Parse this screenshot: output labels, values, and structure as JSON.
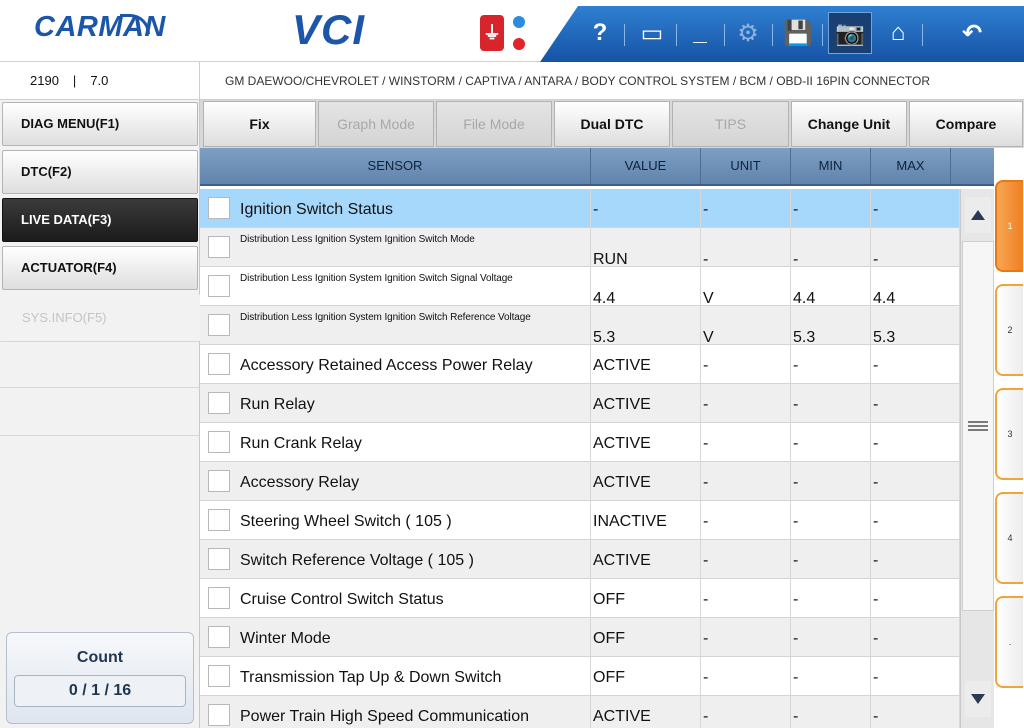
{
  "header": {
    "logo": "CARMAN",
    "product": "VCI",
    "usb_icon": "usb-icon",
    "toolbar": [
      {
        "name": "help-button",
        "label": "?",
        "icon": "question-icon",
        "state": "normal"
      },
      {
        "name": "window-button",
        "label": "▭",
        "icon": "window-icon",
        "state": "normal"
      },
      {
        "name": "minimize-button",
        "label": "_",
        "icon": "minimize-icon",
        "state": "normal"
      },
      {
        "name": "settings-button",
        "label": "⚙",
        "icon": "gear-icon",
        "state": "disabled"
      },
      {
        "name": "save-button",
        "label": "💾",
        "icon": "save-icon",
        "state": "normal"
      },
      {
        "name": "camera-button",
        "label": "📷",
        "icon": "camera-icon",
        "state": "active"
      },
      {
        "name": "home-button",
        "label": "⌂",
        "icon": "home-icon",
        "state": "normal"
      },
      {
        "name": "back-button",
        "label": "↶",
        "icon": "back-icon",
        "state": "normal"
      }
    ]
  },
  "info": {
    "code": "2190",
    "separator": "|",
    "version": "7.0",
    "path": "GM DAEWOO/CHEVROLET / WINSTORM / CAPTIVA / ANTARA / BODY CONTROL SYSTEM / BCM / OBD-II 16PIN CONNECTOR"
  },
  "menu": {
    "items": [
      {
        "label": "DIAG MENU(F1)",
        "state": "normal"
      },
      {
        "label": "DTC(F2)",
        "state": "normal"
      },
      {
        "label": "LIVE DATA(F3)",
        "state": "active"
      },
      {
        "label": "ACTUATOR(F4)",
        "state": "normal"
      },
      {
        "label": "SYS.INFO(F5)",
        "state": "disabled"
      }
    ],
    "count_title": "Count",
    "count_value": "0 / 1 / 16"
  },
  "functions": [
    {
      "label": "Fix",
      "enabled": true
    },
    {
      "label": "Graph Mode",
      "enabled": false
    },
    {
      "label": "File Mode",
      "enabled": false
    },
    {
      "label": "Dual DTC",
      "enabled": true
    },
    {
      "label": "TIPS",
      "enabled": false
    },
    {
      "label": "Change Unit",
      "enabled": true
    },
    {
      "label": "Compare",
      "enabled": true
    }
  ],
  "table": {
    "columns": [
      "SENSOR",
      "VALUE",
      "UNIT",
      "MIN",
      "MAX"
    ],
    "rows": [
      {
        "sensor": "Ignition Switch Status",
        "value": "-",
        "unit": "-",
        "min": "-",
        "max": "-",
        "small": false,
        "selected": true
      },
      {
        "sensor": "Distribution Less Ignition System Ignition Switch Mode",
        "value": "RUN",
        "unit": "-",
        "min": "-",
        "max": "-",
        "small": true,
        "selected": false
      },
      {
        "sensor": "Distribution Less Ignition System Ignition Switch Signal Voltage",
        "value": "4.4",
        "unit": "V",
        "min": "4.4",
        "max": "4.4",
        "small": true,
        "selected": false
      },
      {
        "sensor": "Distribution Less Ignition System Ignition Switch Reference Voltage",
        "value": "5.3",
        "unit": "V",
        "min": "5.3",
        "max": "5.3",
        "small": true,
        "selected": false
      },
      {
        "sensor": "Accessory Retained Access Power Relay",
        "value": "ACTIVE",
        "unit": "-",
        "min": "-",
        "max": "-",
        "small": false,
        "selected": false
      },
      {
        "sensor": "Run Relay",
        "value": "ACTIVE",
        "unit": "-",
        "min": "-",
        "max": "-",
        "small": false,
        "selected": false
      },
      {
        "sensor": "Run Crank Relay",
        "value": "ACTIVE",
        "unit": "-",
        "min": "-",
        "max": "-",
        "small": false,
        "selected": false
      },
      {
        "sensor": "Accessory Relay",
        "value": "ACTIVE",
        "unit": "-",
        "min": "-",
        "max": "-",
        "small": false,
        "selected": false
      },
      {
        "sensor": "Steering Wheel Switch ( 105 )",
        "value": "INACTIVE",
        "unit": "-",
        "min": "-",
        "max": "-",
        "small": false,
        "selected": false
      },
      {
        "sensor": "Switch Reference Voltage ( 105 )",
        "value": "ACTIVE",
        "unit": "-",
        "min": "-",
        "max": "-",
        "small": false,
        "selected": false
      },
      {
        "sensor": "Cruise Control Switch Status",
        "value": "OFF",
        "unit": "-",
        "min": "-",
        "max": "-",
        "small": false,
        "selected": false
      },
      {
        "sensor": "Winter Mode",
        "value": "OFF",
        "unit": "-",
        "min": "-",
        "max": "-",
        "small": false,
        "selected": false
      },
      {
        "sensor": "Transmission Tap Up & Down Switch",
        "value": "OFF",
        "unit": "-",
        "min": "-",
        "max": "-",
        "small": false,
        "selected": false
      },
      {
        "sensor": "Power Train High Speed Communication",
        "value": "ACTIVE",
        "unit": "-",
        "min": "-",
        "max": "-",
        "small": false,
        "selected": false
      }
    ]
  },
  "pages": {
    "tabs": [
      "1",
      "2",
      "3",
      "4",
      "."
    ],
    "active": "1"
  },
  "colors": {
    "brand": "#1c56a8",
    "selected_row": "#a6d8fc",
    "active_tab": "#ef7f22",
    "header_bar": "#1653a4"
  }
}
